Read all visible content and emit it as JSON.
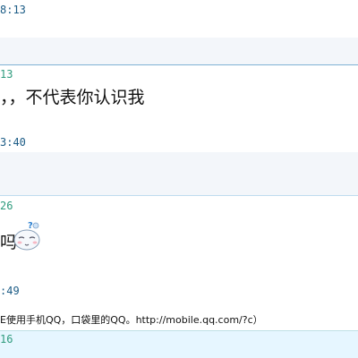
{
  "chat": {
    "entries": [
      {
        "time": "8:13"
      },
      {
        "time": "13",
        "text": "，，不代表你认识我"
      },
      {
        "time": "3:40"
      },
      {
        "time": "26",
        "text": "吗",
        "emoticon": "sleepy-face-emoticon"
      },
      {
        "time": ":49",
        "text": "E使用手机QQ，口袋里的QQ。http://mobile.qq.com/?c）"
      },
      {
        "time": "16"
      }
    ]
  },
  "colors": {
    "timestamp_dark": "#1c5c86",
    "timestamp_green": "#2e9b7d",
    "divider_blue": "#7fb2d4",
    "panel_pale": "#f3f6fa"
  }
}
